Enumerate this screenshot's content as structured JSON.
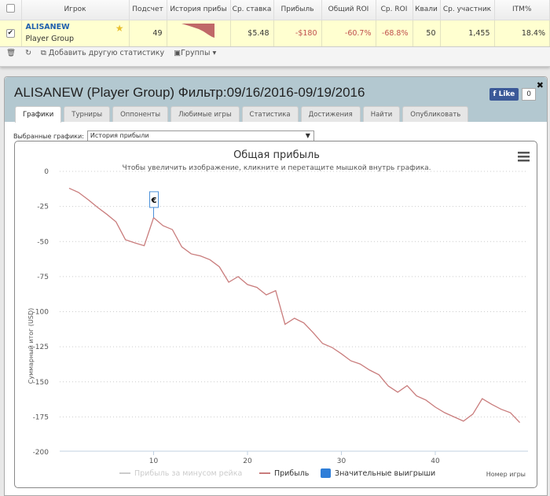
{
  "table": {
    "headers": [
      "Игрок",
      "Подсчет",
      "История прибы",
      "Ср. ставка",
      "Прибыль",
      "Общий ROI",
      "Ср. ROI",
      "Квали",
      "Ср. участник",
      "ITM%"
    ],
    "row": {
      "checked": true,
      "player": "ALISANEW",
      "group": "Player Group",
      "count": "49",
      "avg_stake": "$5.48",
      "profit": "-$180",
      "total_roi": "-60.7%",
      "avg_roi": "-68.8%",
      "quali": "50",
      "avg_entrants": "1,455",
      "itm": "18.4%"
    }
  },
  "toolbar": {
    "add_stat": "Добавить другую статистику",
    "groups": "Группы"
  },
  "dialog": {
    "title": "ALISANEW (Player Group) Фильтр:09/16/2016-09/19/2016",
    "like": "Like",
    "like_count": "0",
    "tabs": [
      "Графики",
      "Турниры",
      "Оппоненты",
      "Любимые игры",
      "Статистика",
      "Достижения",
      "Найти",
      "Опубликовать"
    ],
    "active_tab": "Графики",
    "selected_label": "Выбранные графики:",
    "selected_value": "История прибыли"
  },
  "chart_data": {
    "type": "line",
    "title": "Общая прибыль",
    "subtitle": "Чтобы увеличить изображение, кликните и перетащите мышкой внутрь графика.",
    "xlabel": "Номер игры",
    "ylabel": "Суммарный итог (USD)",
    "xticks": [
      10,
      20,
      30,
      40
    ],
    "yticks": [
      0,
      -25,
      -50,
      -75,
      -100,
      -125,
      -150,
      -175,
      -200
    ],
    "xlim": [
      0,
      50
    ],
    "ylim": [
      -200,
      0
    ],
    "grid": true,
    "legend": [
      "Прибыль за минусом рейка",
      "Прибыль",
      "Значительные выигрыши"
    ],
    "legend_placement": "bottom",
    "series": [
      {
        "name": "Прибыль",
        "color": "#c0504d",
        "x_start": 1,
        "values": [
          -12,
          -15,
          -20,
          -25.5,
          -30.5,
          -36,
          -48.7,
          -51,
          -53,
          -33,
          -38.7,
          -41.5,
          -53.8,
          -58.8,
          -60.3,
          -63,
          -68,
          -79,
          -75,
          -80.7,
          -82.7,
          -88,
          -85,
          -109,
          -104.7,
          -108,
          -115,
          -122.7,
          -125.5,
          -130,
          -135,
          -137.3,
          -141.6,
          -145,
          -153,
          -157.4,
          -152.7,
          -160,
          -163,
          -168,
          -172,
          -175,
          -178,
          -173,
          -162,
          -166,
          -169.5,
          -172,
          -179
        ]
      }
    ],
    "flags": [
      {
        "x": 10,
        "label": "€"
      }
    ]
  }
}
